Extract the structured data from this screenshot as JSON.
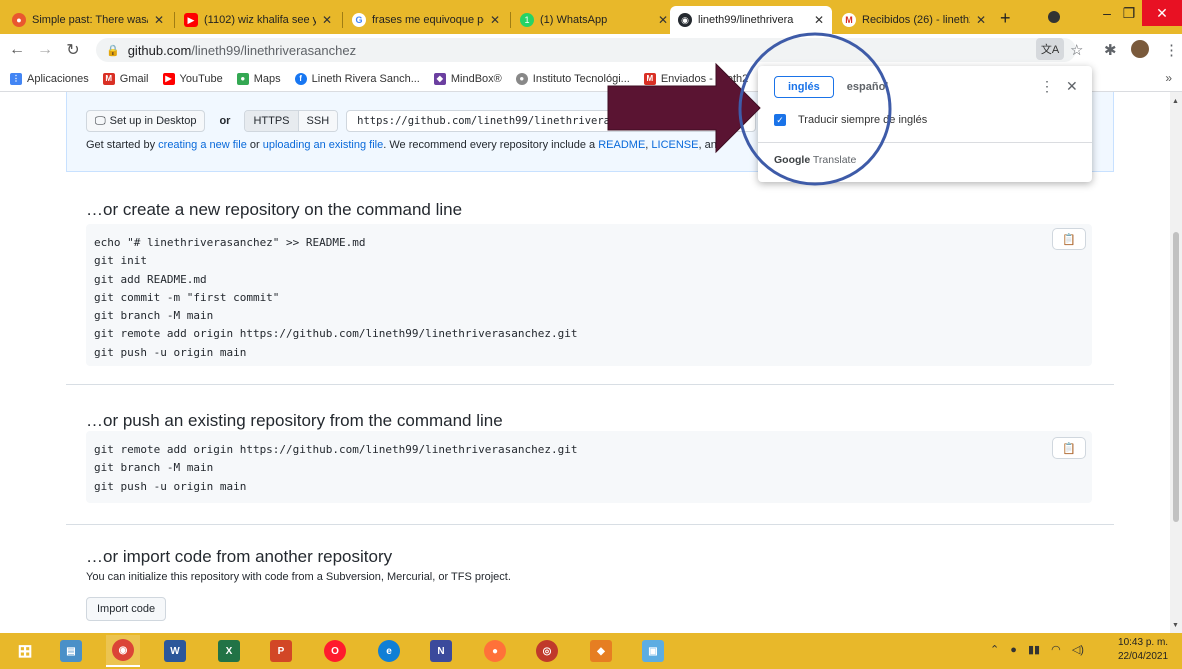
{
  "browser": {
    "tabs": [
      {
        "label": "Simple past: There was/",
        "icon_color": "#e9572f",
        "icon": "circle-icon"
      },
      {
        "label": "(1102) wiz khalifa see yo",
        "icon_color": "#ff0000",
        "icon": "youtube-icon"
      },
      {
        "label": "frases me equivoque pe",
        "icon_color": "#4285f4",
        "icon": "google-icon"
      },
      {
        "label": "(1) WhatsApp",
        "icon_color": "#25d366",
        "icon": "whatsapp-icon"
      },
      {
        "label": "lineth99/linethrivera",
        "icon_color": "#24292f",
        "icon": "github-icon"
      },
      {
        "label": "Recibidos (26) - lineth2",
        "icon_color": "#d93025",
        "icon": "gmail-icon"
      }
    ],
    "url_host": "github.com",
    "url_path": "/lineth99/linethriverasanchez",
    "bookmarks": [
      {
        "label": "Aplicaciones",
        "color": "#4285f4"
      },
      {
        "label": "Gmail",
        "color": "#d93025"
      },
      {
        "label": "YouTube",
        "color": "#ff0000"
      },
      {
        "label": "Maps",
        "color": "#34a853"
      },
      {
        "label": "Lineth Rivera Sanch...",
        "color": "#1877f2"
      },
      {
        "label": "MindBox®",
        "color": "#6b3fa0"
      },
      {
        "label": "Instituto Tecnológi...",
        "color": "#888888"
      },
      {
        "label": "Enviados - lineth2",
        "color": "#d93025"
      }
    ]
  },
  "quick_setup": {
    "desktop_btn": "Set up in Desktop",
    "or": "or",
    "https": "HTTPS",
    "ssh": "SSH",
    "clone_url": "https://github.com/lineth99/linethriverasanchez.git",
    "get_started_1": "Get started by ",
    "link_new_file": "creating a new file",
    "get_started_2": " or ",
    "link_upload": "uploading an existing file",
    "get_started_3": ". We recommend every repository include a ",
    "link_readme": "README",
    "get_started_4": ", ",
    "link_license": "LICENSE",
    "get_started_5": ", an"
  },
  "sections": {
    "create": {
      "title": "…or create a new repository on the command line",
      "code": "echo \"# linethriverasanchez\" >> README.md\ngit init\ngit add README.md\ngit commit -m \"first commit\"\ngit branch -M main\ngit remote add origin https://github.com/lineth99/linethriverasanchez.git\ngit push -u origin main"
    },
    "push": {
      "title": "…or push an existing repository from the command line",
      "code": "git remote add origin https://github.com/lineth99/linethriverasanchez.git\ngit branch -M main\ngit push -u origin main"
    },
    "import": {
      "title": "…or import code from another repository",
      "desc": "You can initialize this repository with code from a Subversion, Mercurial, or TFS project.",
      "button": "Import code"
    }
  },
  "translate_popup": {
    "lang_source": "inglés",
    "lang_target": "español",
    "always_translate": "Traducir siempre de inglés",
    "footer_brand": "Google",
    "footer_product": "Translate"
  },
  "taskbar": {
    "time": "10:43 p. m.",
    "date": "22/04/2021"
  }
}
